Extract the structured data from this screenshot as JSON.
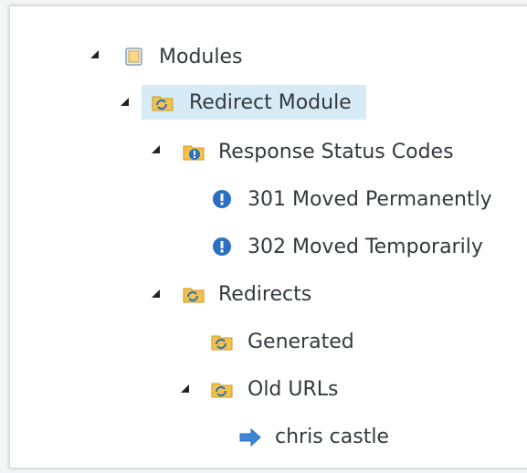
{
  "tree": {
    "modules": {
      "label": "Modules",
      "icon": "module-box-icon"
    },
    "redirect_module": {
      "label": "Redirect Module",
      "icon": "folder-sync-icon",
      "selected": true
    },
    "response_status_codes": {
      "label": "Response Status Codes",
      "icon": "folder-info-icon"
    },
    "status_301": {
      "label": "301 Moved Permanently",
      "icon": "info-circle-icon"
    },
    "status_302": {
      "label": "302 Moved Temporarily",
      "icon": "info-circle-icon"
    },
    "redirects": {
      "label": "Redirects",
      "icon": "folder-sync-icon"
    },
    "generated": {
      "label": "Generated",
      "icon": "folder-sync-icon"
    },
    "old_urls": {
      "label": "Old URLs",
      "icon": "folder-sync-icon"
    },
    "chris_castle": {
      "label": "chris castle",
      "icon": "arrow-right-icon"
    }
  },
  "colors": {
    "selection": "#d6ebf5",
    "folder": "#f3c24a",
    "info": "#2a6fc4"
  }
}
